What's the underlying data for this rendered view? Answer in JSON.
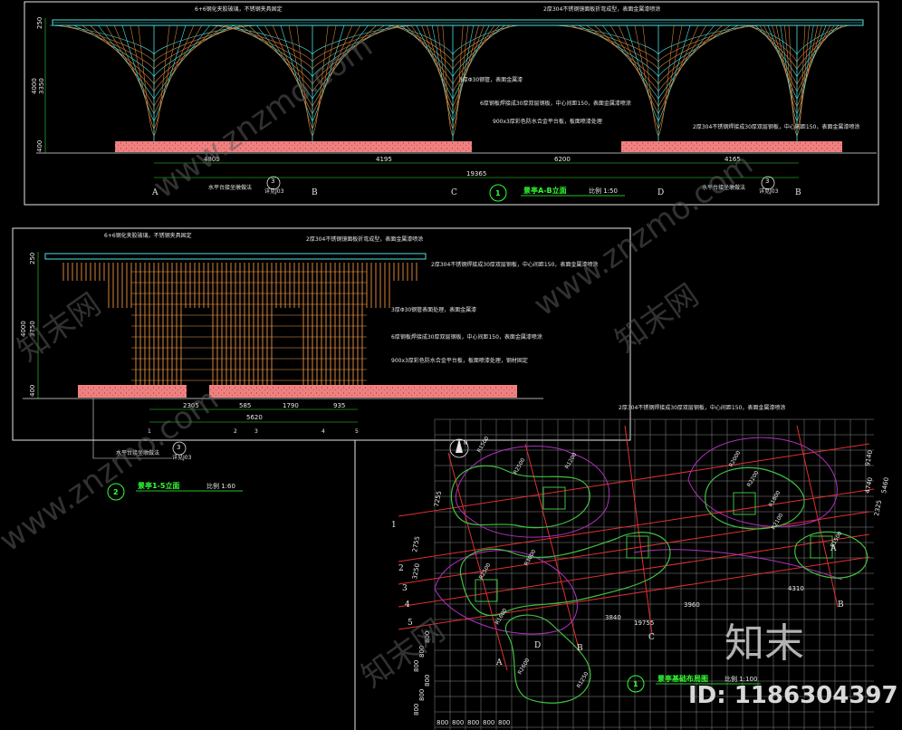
{
  "colors": {
    "background": "#000000",
    "frame": "#e6e6e6",
    "base_slab": "#f08080",
    "structure": "#d6843a",
    "cyan_line": "#4fe0e0",
    "title_green": "#33ff33",
    "grid_line": "#8a8a8a",
    "red_axis": "#e03030",
    "magenta_curve": "#b030c0",
    "green_curve": "#40c040"
  },
  "view1": {
    "notes": {
      "top_left": "6+6钢化夹胶玻璃，不锈钢夹具固定",
      "top_right": "2厚304不锈钢镜面板折弯成型，表面金属漆喷涂",
      "mid1": "3厚Φ30钢管，表面金属漆",
      "mid2": "6厚钢板焊接成30厚双层钢板，中心间距150，表面金属漆喷涂",
      "mid3": "900x3厚彩色防水合金平台板，板面喷漆处理",
      "right": "2厚304不锈钢焊接成30厚双层钢板，中心间距150，表面金属漆喷涂"
    },
    "dims_left": [
      "250",
      "4000",
      "3350",
      "400"
    ],
    "dims_bottom": [
      "4805",
      "4195",
      "6200",
      "4165"
    ],
    "dim_total": "19365",
    "grid_labels": [
      "A",
      "B",
      "C",
      "D",
      "B"
    ],
    "callout_left": "水平台接坐墩做法",
    "callout_right": "水平台接坐墩做法",
    "callout_num": "3",
    "callout_sheet": "详见J03",
    "title_num": "1",
    "title": "景亭A-B立面",
    "scale": "比例 1:50"
  },
  "view2": {
    "notes": {
      "top_left": "6+6钢化夹胶玻璃，不锈钢夹具固定",
      "top_right": "2厚304不锈钢镜面板折弯成型，表面金属漆喷涂",
      "right1": "2厚304不锈钢焊接成30厚双层钢板，中心间距150，表面金属漆喷涂",
      "right2": "3厚Φ30钢管表面处理，表面金属漆",
      "right3": "6厚钢板焊接成30厚双层钢板，中心间距150，表面金属漆喷涂",
      "right4": "900x3厚彩色防水合金平台板，板面喷漆处理，钢材固定"
    },
    "dims_left": [
      "250",
      "4000",
      "3750",
      "400"
    ],
    "dims_bottom": [
      "2305",
      "585",
      "1790",
      "935"
    ],
    "dim_total": "5620",
    "grid_labels": [
      "1",
      "2",
      "3",
      "4",
      "5"
    ],
    "callout": "水平台接坐墩做法",
    "callout_num": "3",
    "callout_sheet": "详见J03",
    "title_num": "2",
    "title": "景亭1-5立面",
    "scale": "比例 1:60"
  },
  "view3": {
    "note": "2厚304不锈钢焊接成30厚双层钢板，中心间距150，表面金属漆喷涂",
    "north_label": "N",
    "radii": [
      "R1500",
      "R2500",
      "R1200",
      "R2000",
      "R2200",
      "R1800",
      "R2100",
      "R1500",
      "R3000",
      "R2500",
      "R1600",
      "R2600",
      "R1250"
    ],
    "dims": [
      "3960",
      "4310",
      "3840",
      "19755",
      "7255",
      "4740",
      "2755",
      "9140",
      "3250",
      "2325",
      "5460"
    ],
    "grid_labels": [
      "1",
      "2",
      "3",
      "4",
      "5",
      "A",
      "B",
      "C",
      "D",
      "A",
      "B"
    ],
    "bottom_dims": [
      "800",
      "800",
      "800",
      "800",
      "800"
    ],
    "left_dims": [
      "800",
      "800",
      "800",
      "800",
      "800",
      "800"
    ],
    "title_num": "1",
    "title": "景亭基础布局图",
    "scale": "比例 1:100"
  },
  "watermarks": {
    "site": "www.znzmo.com",
    "brand": "知末网",
    "logo": "知末",
    "id_text": "ID: 1186304397"
  }
}
